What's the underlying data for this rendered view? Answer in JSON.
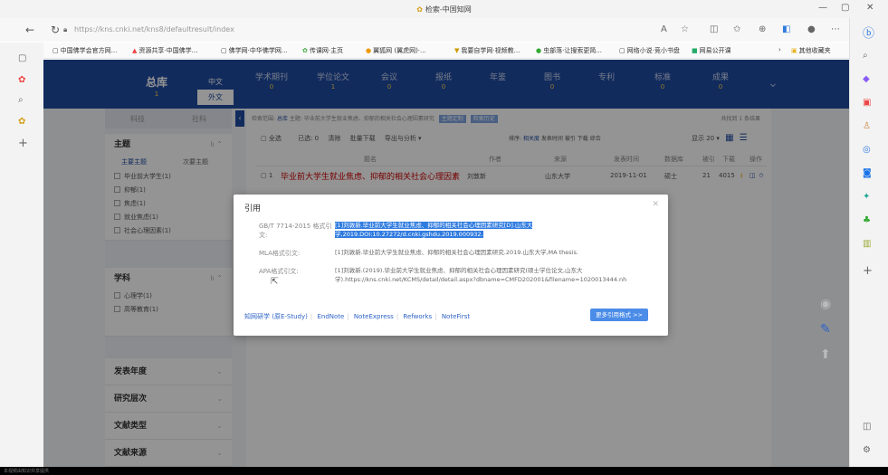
{
  "window": {
    "title": "检索-中国知网",
    "controls": [
      "—",
      "▢",
      "✕"
    ]
  },
  "address": {
    "host": "https://kns.cnki.net",
    "path": "/kns8/defaultresult/index"
  },
  "bookmarks": [
    {
      "icon": "▢",
      "label": "中国佛学会官方网..."
    },
    {
      "icon": "▲",
      "label": "资源共享·中国佛学..."
    },
    {
      "icon": "▢",
      "label": "佛学网·中华佛学网..."
    },
    {
      "icon": "✿",
      "label": "传课网·主页"
    },
    {
      "icon": "●",
      "label": "翼狐网 (翼虎网)·..."
    },
    {
      "icon": "▼",
      "label": "我要自学网·视频教..."
    },
    {
      "icon": "●",
      "label": "虫部落·让搜索更简..."
    },
    {
      "icon": "▢",
      "label": "网络小说·竞小书盘"
    },
    {
      "icon": "■",
      "label": "网易公开课"
    },
    {
      "icon": "▣",
      "label": "其他收藏夹"
    }
  ],
  "dbnav": {
    "main": {
      "name": "总库",
      "count": "1"
    },
    "lang": {
      "zh": "中文",
      "en": "外文"
    },
    "tabs": [
      {
        "name": "学术期刊",
        "count": "0"
      },
      {
        "name": "学位论文",
        "count": "1"
      },
      {
        "name": "会议",
        "count": "0"
      },
      {
        "name": "报纸",
        "count": "0"
      },
      {
        "name": "年鉴",
        "count": ""
      },
      {
        "name": "图书",
        "count": "0"
      },
      {
        "name": "专利",
        "count": ""
      },
      {
        "name": "标准",
        "count": "0"
      },
      {
        "name": "成果",
        "count": "0"
      }
    ]
  },
  "filter": {
    "tabs": [
      "科技",
      "社科"
    ],
    "topic": {
      "heading": "主题",
      "sub": [
        "主要主题",
        "次要主题"
      ],
      "items": [
        "毕业前大学生(1)",
        "抑郁(1)",
        "焦虑(1)",
        "就业焦虑(1)",
        "社会心理因素(1)"
      ]
    },
    "subject": {
      "heading": "学科",
      "items": [
        "心理学(1)",
        "高等教育(1)"
      ]
    },
    "collapsed": [
      "发表年度",
      "研究层次",
      "文献类型",
      "文献来源"
    ]
  },
  "results": {
    "crumb_prefix": "检索范围:",
    "crumb_db": "总库",
    "crumb_query": "主题: 毕业前大学生就业焦虑、抑郁的相关社会心理因素研究",
    "crumb_btn1": "主题定制",
    "crumb_btn2": "检索历史",
    "found": "共找到 1 条结果",
    "select_all": "全选",
    "selected": "已选: 0",
    "clear": "清除",
    "batch": "批量下载",
    "export": "导出与分析 ▾",
    "sort_label": "排序:",
    "sort_options": [
      "相关度",
      "发表时间",
      "被引",
      "下载",
      "综合"
    ],
    "show": "显示 20 ▾",
    "columns": [
      "题名",
      "作者",
      "来源",
      "发表时间",
      "数据库",
      "被引",
      "下载",
      "操作"
    ],
    "row": {
      "title": "毕业前大学生就业焦虑、抑郁的相关社会心理因素",
      "author": "刘敦新",
      "source": "山东大学",
      "date": "2019-11-01",
      "db": "硕士",
      "cited": "21",
      "downloads": "4015"
    }
  },
  "dialog": {
    "title": "引用",
    "close": "✕",
    "citations": [
      {
        "label": "GB/T 7714-2015 格式引文:",
        "text": "[1]刘敦新.毕业前大学生就业焦虑、抑郁的相关社会心理因素研究[D].山东大学,2019.DOI:10.27272/d.cnki.gshdu.2019.000932."
      },
      {
        "label": "MLA格式引文:",
        "text": "[1]刘敦新.毕业前大学生就业焦虑、抑郁的相关社会心理因素研究.2019.山东大学,MA thesis."
      },
      {
        "label": "APA格式引文:",
        "text": "[1]刘敦新.(2019).毕业前大学生就业焦虑、抑郁的相关社会心理因素研究(硕士学位论文,山东大学).https://kns.cnki.net/KCMS/detail/detail.aspx?dbname=CMFD202001&filename=1020013444.nh"
      }
    ],
    "links": [
      "知网研学 (原E-Study)",
      "EndNote",
      "NoteExpress",
      "Refworks",
      "NoteFirst"
    ],
    "more_button": "更多引用格式 >>"
  },
  "footer_note": "本视频由知识共享提供"
}
